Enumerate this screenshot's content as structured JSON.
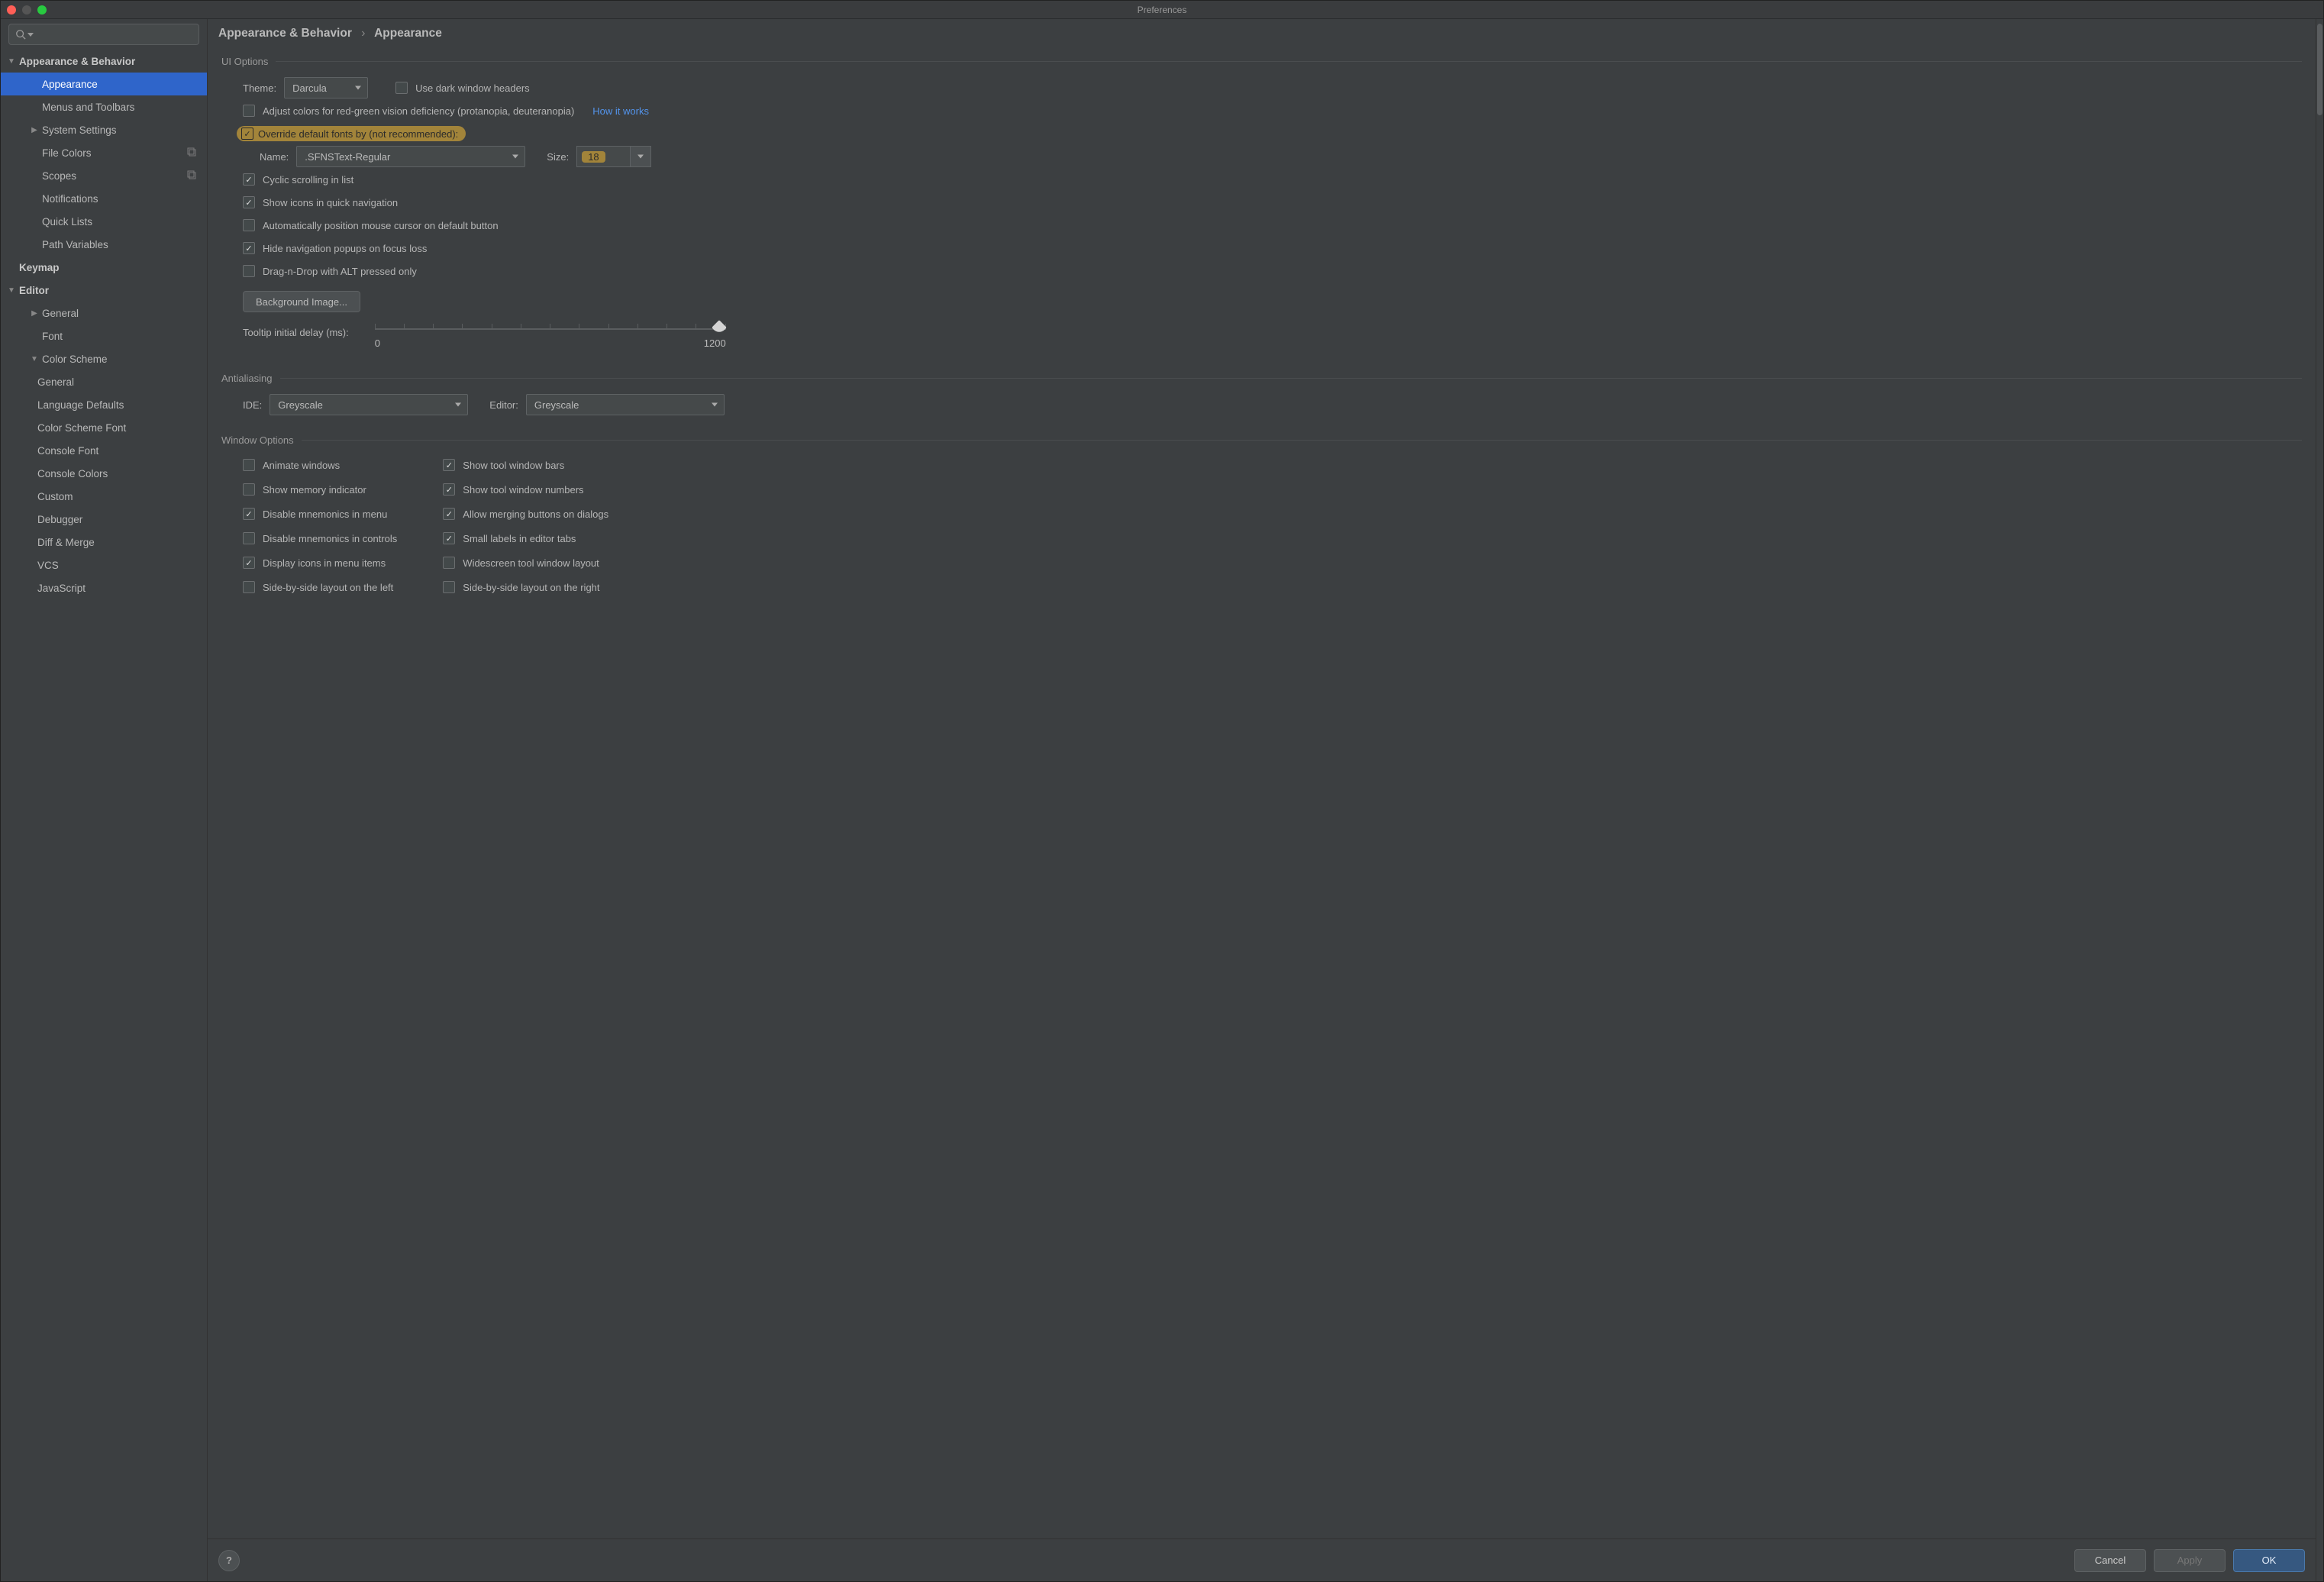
{
  "window": {
    "title": "Preferences"
  },
  "breadcrumb": {
    "root": "Appearance & Behavior",
    "leaf": "Appearance"
  },
  "sidebar": {
    "items": [
      {
        "label": "Appearance & Behavior",
        "level": 0,
        "bold": true,
        "expand": "▼"
      },
      {
        "label": "Appearance",
        "level": 1,
        "selected": true
      },
      {
        "label": "Menus and Toolbars",
        "level": 1
      },
      {
        "label": "System Settings",
        "level": 1,
        "expand": "▶"
      },
      {
        "label": "File Colors",
        "level": 1,
        "tag": true
      },
      {
        "label": "Scopes",
        "level": 1,
        "tag": true
      },
      {
        "label": "Notifications",
        "level": 1
      },
      {
        "label": "Quick Lists",
        "level": 1
      },
      {
        "label": "Path Variables",
        "level": 1
      },
      {
        "label": "Keymap",
        "level": 0,
        "bold": true,
        "noarrow": true
      },
      {
        "label": "Editor",
        "level": 0,
        "bold": true,
        "expand": "▼"
      },
      {
        "label": "General",
        "level": 1,
        "expand": "▶"
      },
      {
        "label": "Font",
        "level": 1
      },
      {
        "label": "Color Scheme",
        "level": 1,
        "expand": "▼"
      },
      {
        "label": "General",
        "level": 2
      },
      {
        "label": "Language Defaults",
        "level": 2
      },
      {
        "label": "Color Scheme Font",
        "level": 2
      },
      {
        "label": "Console Font",
        "level": 2
      },
      {
        "label": "Console Colors",
        "level": 2
      },
      {
        "label": "Custom",
        "level": 2
      },
      {
        "label": "Debugger",
        "level": 2
      },
      {
        "label": "Diff & Merge",
        "level": 2
      },
      {
        "label": "VCS",
        "level": 2
      },
      {
        "label": "JavaScript",
        "level": 2
      }
    ]
  },
  "ui": {
    "section": "UI Options",
    "themeLabel": "Theme:",
    "themeValue": "Darcula",
    "darkHeaders": "Use dark window headers",
    "adjustColors": "Adjust colors for red-green vision deficiency (protanopia, deuteranopia)",
    "howItWorks": "How it works",
    "overrideFonts": "Override default fonts by (not recommended):",
    "nameLabel": "Name:",
    "nameValue": ".SFNSText-Regular",
    "sizeLabel": "Size:",
    "sizeValue": "18",
    "cyclic": "Cyclic scrolling in list",
    "showIcons": "Show icons in quick navigation",
    "autoPos": "Automatically position mouse cursor on default button",
    "hideNav": "Hide navigation popups on focus loss",
    "dnd": "Drag-n-Drop with ALT pressed only",
    "bgImage": "Background Image...",
    "tooltipLabel": "Tooltip initial delay (ms):",
    "sliderMin": "0",
    "sliderMax": "1200"
  },
  "aa": {
    "section": "Antialiasing",
    "ideLabel": "IDE:",
    "ideValue": "Greyscale",
    "editorLabel": "Editor:",
    "editorValue": "Greyscale"
  },
  "win": {
    "section": "Window Options",
    "left": [
      {
        "label": "Animate windows",
        "checked": false
      },
      {
        "label": "Show memory indicator",
        "checked": false
      },
      {
        "label": "Disable mnemonics in menu",
        "checked": true
      },
      {
        "label": "Disable mnemonics in controls",
        "checked": false
      },
      {
        "label": "Display icons in menu items",
        "checked": true
      },
      {
        "label": "Side-by-side layout on the left",
        "checked": false
      }
    ],
    "right": [
      {
        "label": "Show tool window bars",
        "checked": true
      },
      {
        "label": "Show tool window numbers",
        "checked": true
      },
      {
        "label": "Allow merging buttons on dialogs",
        "checked": true
      },
      {
        "label": "Small labels in editor tabs",
        "checked": true
      },
      {
        "label": "Widescreen tool window layout",
        "checked": false
      },
      {
        "label": "Side-by-side layout on the right",
        "checked": false
      }
    ]
  },
  "footer": {
    "cancel": "Cancel",
    "apply": "Apply",
    "ok": "OK"
  }
}
